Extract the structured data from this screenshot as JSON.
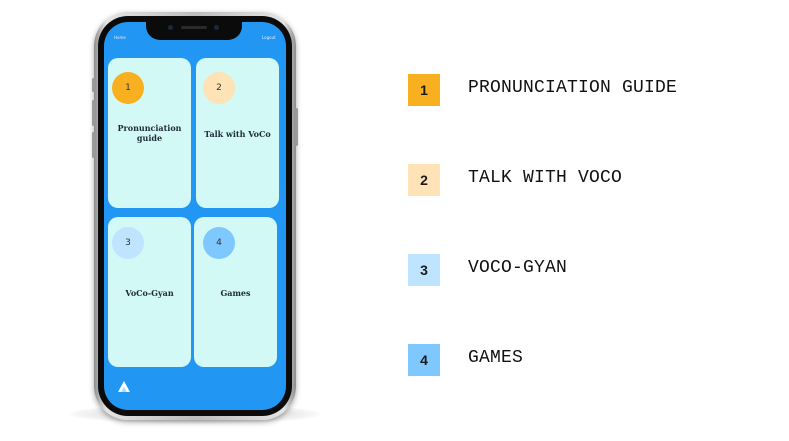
{
  "status_bar": {
    "left": "Home",
    "right": "Logout"
  },
  "cards": [
    {
      "number": "1",
      "title_line1": "Pronunciation",
      "title_line2": "guide",
      "circle_color": "#f8b020"
    },
    {
      "number": "2",
      "title_line1": "Talk with VoCo",
      "title_line2": "",
      "circle_color": "#fde3b5"
    },
    {
      "number": "3",
      "title_line1": "VoCo-Gyan",
      "title_line2": "",
      "circle_color": "#bfe4ff"
    },
    {
      "number": "4",
      "title_line1": "Games",
      "title_line2": "",
      "circle_color": "#7fc7ff"
    }
  ],
  "legend": [
    {
      "number": "1",
      "label": "PRONUNCIATION GUIDE",
      "color": "#f8b020"
    },
    {
      "number": "2",
      "label": "TALK WITH VOCO",
      "color": "#fde3b5"
    },
    {
      "number": "3",
      "label": "VOCO-GYAN",
      "color": "#bfe4ff"
    },
    {
      "number": "4",
      "label": "GAMES",
      "color": "#7fc7ff"
    }
  ],
  "colors": {
    "screen": "#2196f3",
    "card": "#d2f9f5"
  },
  "icons": {
    "app_logo": "a-logo-icon"
  }
}
